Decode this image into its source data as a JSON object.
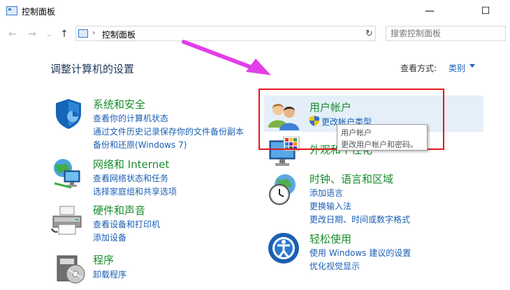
{
  "window": {
    "title": "控制面板",
    "minimize": "—",
    "maximize": "☐"
  },
  "nav": {
    "back": "←",
    "forward": "→",
    "up": "↑"
  },
  "address": {
    "separator": "›",
    "path": "控制面板",
    "dropdown": "⌄",
    "refresh": "↻"
  },
  "search": {
    "placeholder": "搜索控制面板"
  },
  "main": {
    "heading": "调整计算机的设置",
    "view_by_label": "查看方式:",
    "view_by_value": "类别"
  },
  "categories": [
    {
      "title": "系统和安全",
      "links": [
        "查看你的计算机状态",
        "通过文件历史记录保存你的文件备份副本",
        "备份和还原(Windows 7)"
      ]
    },
    {
      "title": "网络和 Internet",
      "links": [
        "查看网络状态和任务",
        "选择家庭组和共享选项"
      ]
    },
    {
      "title": "硬件和声音",
      "links": [
        "查看设备和打印机",
        "添加设备"
      ]
    },
    {
      "title": "程序",
      "links": [
        "卸载程序"
      ]
    },
    {
      "title": "用户帐户",
      "links": [
        "更改帐户类型"
      ]
    },
    {
      "title": "外观和个性化",
      "links": []
    },
    {
      "title": "时钟、语言和区域",
      "links": [
        "添加语言",
        "更换输入法",
        "更改日期、时间或数字格式"
      ]
    },
    {
      "title": "轻松使用",
      "links": [
        "使用 Windows 建议的设置",
        "优化视觉显示"
      ]
    }
  ],
  "tooltip": {
    "title": "用户帐户",
    "desc": "更改用户帐户和密码。"
  },
  "annotation": {
    "arrow_color": "#e23ee8",
    "box_color": "#e3171d"
  },
  "icons": [
    "shield-icon",
    "network-globe-icon",
    "printer-icon",
    "programs-icon",
    "users-icon",
    "monitor-palette-icon",
    "clock-globe-icon",
    "ease-of-access-icon",
    "uac-shield-icon"
  ]
}
